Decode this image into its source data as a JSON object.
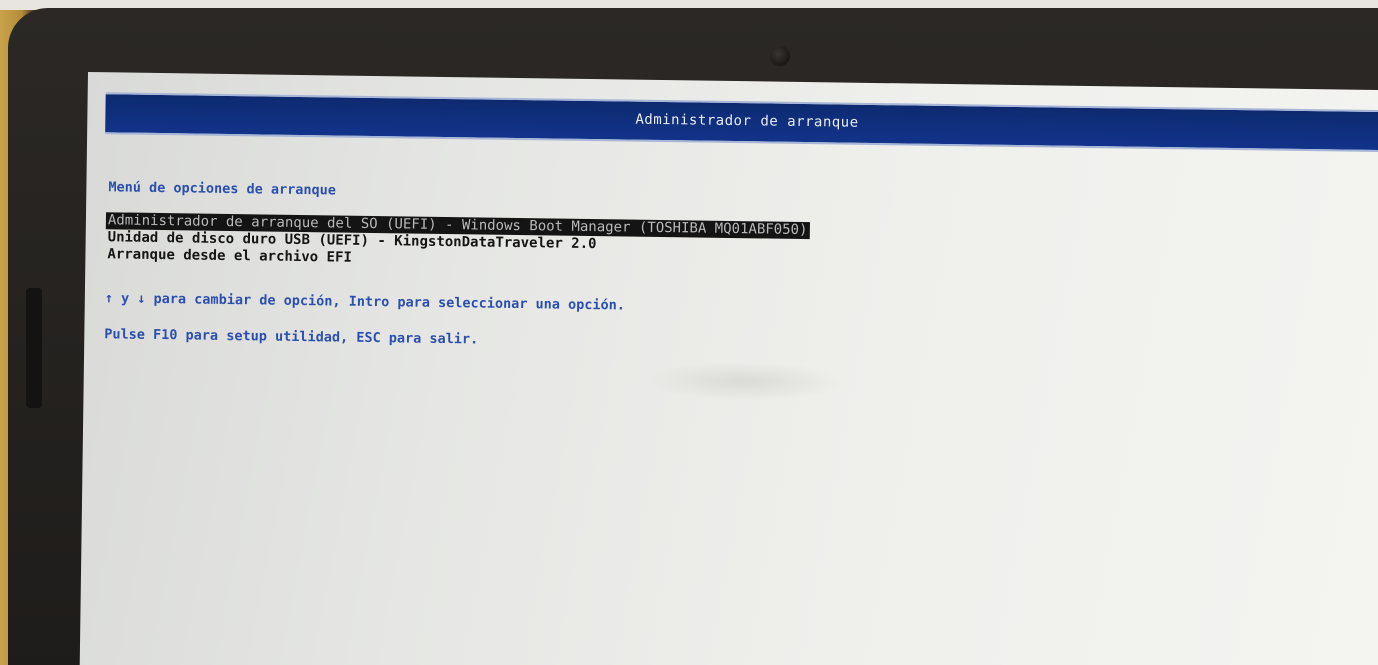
{
  "title_bar": {
    "title": "Administrador de arranque"
  },
  "menu": {
    "heading": "Menú de opciones de arranque",
    "options": [
      {
        "label": "Administrador de arranque del SO (UEFI) - Windows Boot Manager (TOSHIBA MQ01ABF050)",
        "selected": true
      },
      {
        "label": "Unidad de disco duro USB (UEFI) - KingstonDataTraveler 2.0",
        "selected": false
      },
      {
        "label": "Arranque desde el archivo EFI",
        "selected": false
      }
    ]
  },
  "hints": {
    "navigation": "↑ y ↓ para cambiar de opción, Intro para seleccionar una opción.",
    "exit": "Pulse F10 para setup utilidad, ESC para salir."
  },
  "colors": {
    "title_bar_bg": "#12338a",
    "hint_text": "#2b4fae",
    "selected_bg": "#141414",
    "screen_bg": "#e6e7e4"
  }
}
